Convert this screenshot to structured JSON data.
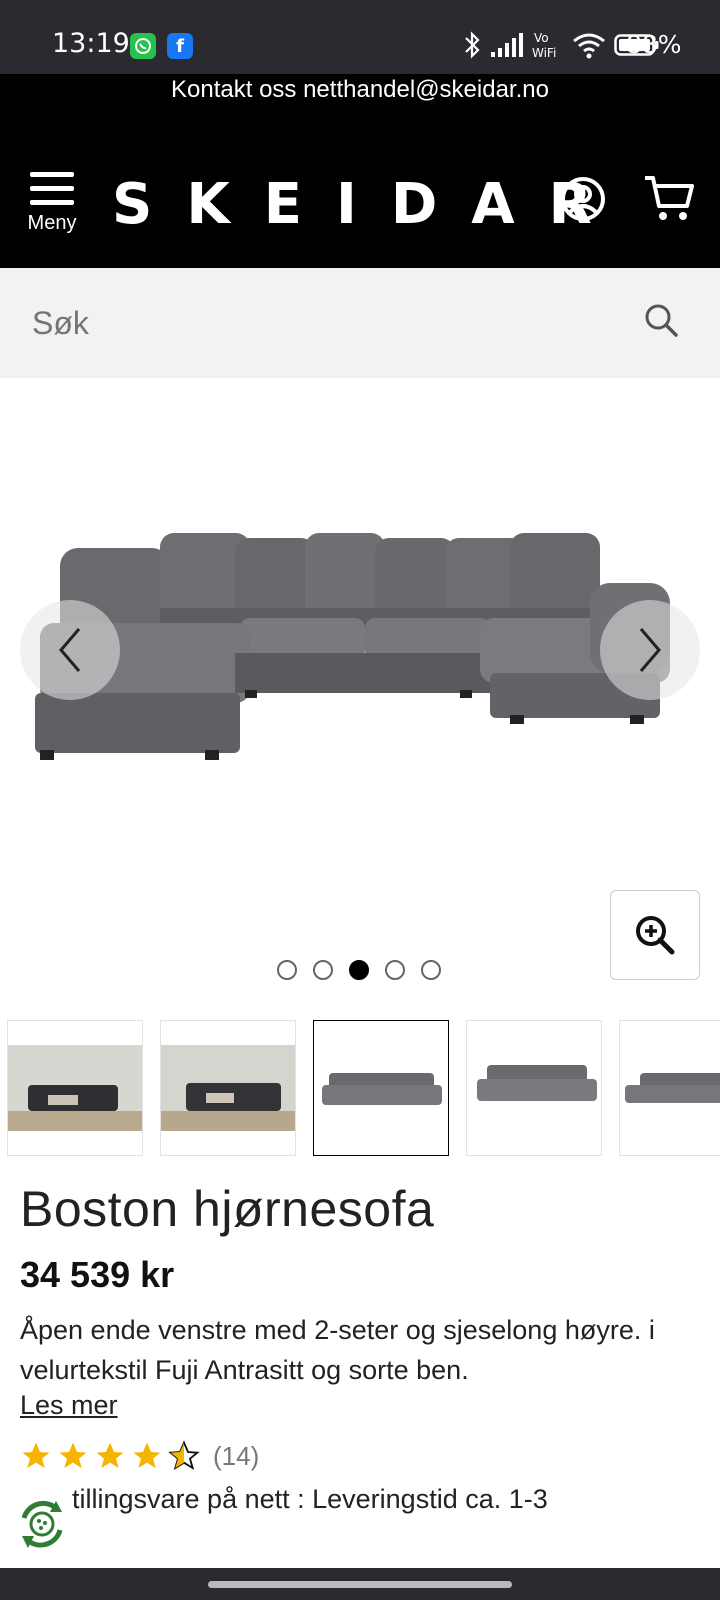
{
  "status_bar": {
    "time": "13:19",
    "battery": "88%",
    "apps": [
      "whatsapp-icon",
      "facebook-icon"
    ],
    "indicators": [
      "bluetooth-icon",
      "signal-icon",
      "vowifi-icon",
      "wifi-icon",
      "battery-icon"
    ]
  },
  "contact": {
    "text": "Kontakt oss netthandel@skeidar.no"
  },
  "header": {
    "menu_label": "Meny",
    "logo": "SKEIDAR"
  },
  "search": {
    "placeholder": "Søk"
  },
  "gallery": {
    "image_count": 5,
    "active_index": 2
  },
  "product": {
    "title": "Boston hjørnesofa",
    "price": "34 539 kr",
    "description": "Åpen ende venstre med 2-seter og sjeselong høyre. i velurtekstil Fuji Antrasitt og sorte ben.",
    "read_more": "Les mer",
    "rating": 4.5,
    "rating_count": "(14)",
    "delivery": "tillingsvare på nett : Leveringstid ca. 1-3"
  },
  "colors": {
    "header_bg": "#000000",
    "search_bg": "#f2f2f2",
    "star": "#f4b400",
    "sofa": "#6f6f73"
  }
}
